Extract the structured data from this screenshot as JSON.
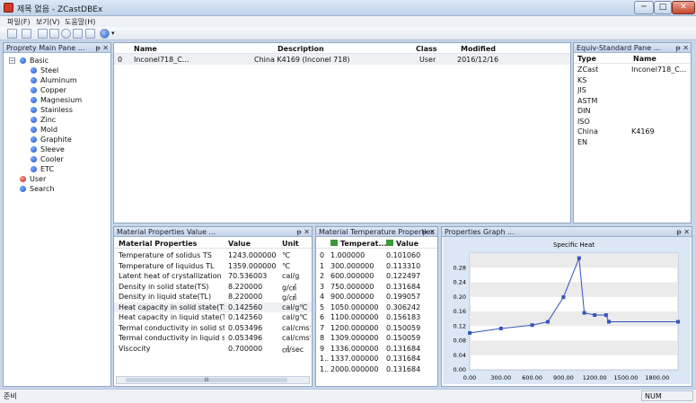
{
  "window": {
    "title": "제목 없음 - ZCastDBEx",
    "min_glyph": "─",
    "max_glyph": "□",
    "close_glyph": "✕"
  },
  "menu": [
    "파일(F)",
    "보기(V)",
    "도움말(H)"
  ],
  "panes": {
    "main": "Proprety Main Pane ...",
    "equiv": "Equiv-Standard Pane ...",
    "value": "Material Properties Value ...",
    "temp": "Material Temperature Properties ...",
    "graph": "Properties Graph ..."
  },
  "pane_buttons": {
    "pin": "ᵽ",
    "close": "✕"
  },
  "tree": {
    "root": "Basic",
    "children": [
      "Steel",
      "Aluminum",
      "Copper",
      "Magnesium",
      "Stainless",
      "Zinc",
      "Mold",
      "Graphite",
      "Sleeve",
      "Cooler",
      "ETC"
    ],
    "others": [
      "User",
      "Search"
    ]
  },
  "materials": {
    "headers": {
      "name": "Name",
      "description": "Description",
      "class": "Class",
      "modified": "Modified"
    },
    "rows": [
      {
        "index": "0",
        "name": "Inconel718_C...",
        "description": "China K4169 (Inconel 718)",
        "class": "User",
        "modified": "2016/12/16"
      }
    ]
  },
  "equiv": {
    "headers": {
      "type": "Type",
      "name": "Name"
    },
    "rows": [
      {
        "type": "ZCast",
        "name": "Inconel718_C..."
      },
      {
        "type": "KS",
        "name": ""
      },
      {
        "type": "JIS",
        "name": ""
      },
      {
        "type": "ASTM",
        "name": ""
      },
      {
        "type": "DIN",
        "name": ""
      },
      {
        "type": "ISO",
        "name": ""
      },
      {
        "type": "China",
        "name": "K4169"
      },
      {
        "type": "EN",
        "name": ""
      }
    ]
  },
  "props": {
    "headers": {
      "prop": "Material Properties",
      "value": "Value",
      "unit": "Unit"
    },
    "rows": [
      {
        "prop": "Temperature of solidus TS",
        "value": "1243.000000",
        "unit": "℃"
      },
      {
        "prop": "Temperature of liquidus TL",
        "value": "1359.000000",
        "unit": "℃"
      },
      {
        "prop": "Latent heat of crystallization",
        "value": "70.536003",
        "unit": "cal/g"
      },
      {
        "prop": "Density in solid state(TS)",
        "value": "8.220000",
        "unit": "g/㎤"
      },
      {
        "prop": "Density in liquid state(TL)",
        "value": "8.220000",
        "unit": "g/㎤"
      },
      {
        "prop": "Heat capacity in solid state(TS)",
        "value": "0.142560",
        "unit": "cal/g℃"
      },
      {
        "prop": "Heat capacity in liquid state(TL)",
        "value": "0.142560",
        "unit": "cal/g℃"
      },
      {
        "prop": "Termal conductivity in solid state(...",
        "value": "0.053496",
        "unit": "cal/cms℃"
      },
      {
        "prop": "Termal conductivity in liquid state...",
        "value": "0.053496",
        "unit": "cal/cms℃"
      },
      {
        "prop": "Viscocity",
        "value": "0.700000",
        "unit": "㎠/sec"
      }
    ],
    "scroll_thumb": "III"
  },
  "temps": {
    "headers": {
      "temp": "Temperat...",
      "value": "Value"
    },
    "rows": [
      {
        "i": "0",
        "t": "1.000000",
        "v": "0.101060"
      },
      {
        "i": "1",
        "t": "300.000000",
        "v": "0.113310"
      },
      {
        "i": "2",
        "t": "600.000000",
        "v": "0.122497"
      },
      {
        "i": "3",
        "t": "750.000000",
        "v": "0.131684"
      },
      {
        "i": "4",
        "t": "900.000000",
        "v": "0.199057"
      },
      {
        "i": "5",
        "t": "1050.000000",
        "v": "0.306242"
      },
      {
        "i": "6",
        "t": "1100.000000",
        "v": "0.156183"
      },
      {
        "i": "7",
        "t": "1200.000000",
        "v": "0.150059"
      },
      {
        "i": "8",
        "t": "1309.000000",
        "v": "0.150059"
      },
      {
        "i": "9",
        "t": "1336.000000",
        "v": "0.131684"
      },
      {
        "i": "1..",
        "t": "1337.000000",
        "v": "0.131684"
      },
      {
        "i": "1..",
        "t": "2000.000000",
        "v": "0.131684"
      }
    ]
  },
  "chart_data": {
    "type": "line",
    "title": "Specific Heat",
    "x": [
      1,
      300,
      600,
      750,
      900,
      1050,
      1100,
      1200,
      1309,
      1336,
      1337,
      2000
    ],
    "y": [
      0.10106,
      0.11331,
      0.122497,
      0.131684,
      0.199057,
      0.306242,
      0.156183,
      0.150059,
      0.150059,
      0.131684,
      0.131684,
      0.131684
    ],
    "xlim": [
      0,
      2000
    ],
    "ylim": [
      0,
      0.32
    ],
    "xticks": [
      "0.00",
      "300.00",
      "600.00",
      "900.00",
      "1200.00",
      "1500.00",
      "1800.00"
    ],
    "yticks": [
      "0.00",
      "0.04",
      "0.08",
      "0.12",
      "0.16",
      "0.20",
      "0.24",
      "0.28"
    ],
    "color": "#3355bb",
    "grid": true
  },
  "status": {
    "left": "준비",
    "right": "NUM"
  }
}
